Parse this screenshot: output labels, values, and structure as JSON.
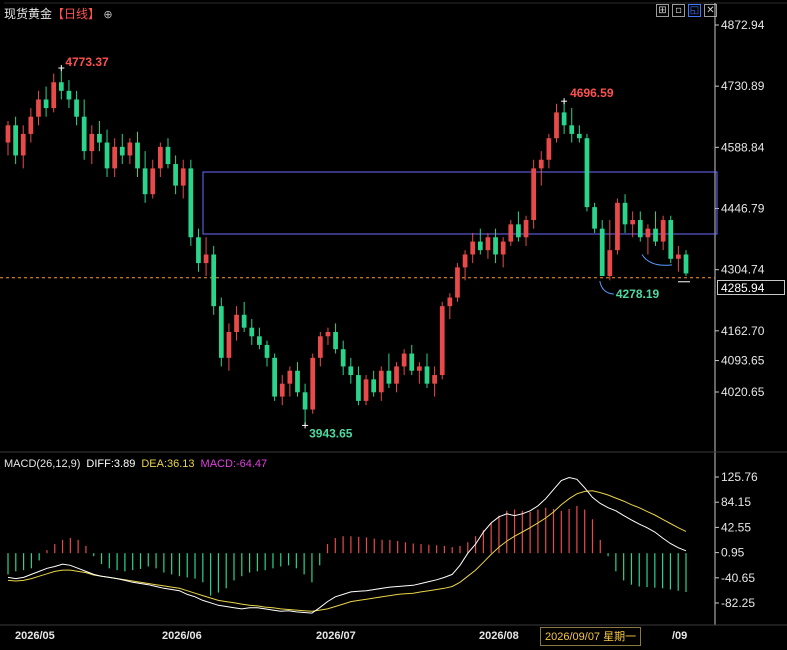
{
  "header": {
    "symbol": "现货黄金",
    "timeframe": "【日线】",
    "add_icon": "circle-plus-icon",
    "window_buttons": [
      {
        "name": "crosshair-icon",
        "glyph": "⊞"
      },
      {
        "name": "minimize-icon",
        "glyph": "▫"
      },
      {
        "name": "expand-icon",
        "glyph": "◱"
      },
      {
        "name": "close-icon",
        "glyph": "✕"
      }
    ]
  },
  "colors": {
    "up": "#e84a4a",
    "down": "#2ad48b",
    "diff_line": "#ffffff",
    "dea_line": "#e8d44a",
    "box": "#6b6bff",
    "dashed": "#ff9a2e",
    "axis": "#c8c8c8",
    "annot_high": "#ff5050",
    "annot_low": "#4dd9a0"
  },
  "price_panel": {
    "y_ticks": [
      "4872.94",
      "4730.89",
      "4588.84",
      "4446.79",
      "4304.74",
      "4162.70",
      "4093.65",
      "4020.65"
    ],
    "current_price": "4285.94",
    "annotations": {
      "high_label": "4773.37",
      "mid_high_label": "4696.59",
      "low_label": "3943.65",
      "recent_low_label": "4278.19"
    }
  },
  "macd_panel": {
    "title": "MACD(26,12,9)",
    "diff_text": "DIFF:3.89",
    "dea_text": "DEA:36.13",
    "macd_text": "MACD:-64.47",
    "y_ticks": [
      "125.76",
      "84.15",
      "42.55",
      "0.95",
      "-40.65",
      "-82.25"
    ]
  },
  "x_axis": {
    "labels": [
      "2026/05",
      "2026/06",
      "2026/07",
      "2026/08",
      "/09"
    ],
    "hover_label": "2026/09/07 星期一"
  },
  "chart_data": [
    {
      "type": "candlestick",
      "title": "现货黄金【日线】",
      "ylim": [
        3943.65,
        4872.94
      ],
      "y_ticks": [
        4872.94,
        4730.89,
        4588.84,
        4446.79,
        4304.74,
        4162.7,
        4093.65,
        4020.65
      ],
      "x_labels": [
        "2026/05",
        "2026/06",
        "2026/07",
        "2026/08",
        "/09"
      ],
      "current_price": 4285.94,
      "annotated_high": 4773.37,
      "annotated_high_2": 4696.59,
      "annotated_low": 3943.65,
      "annotated_recent_low": 4278.19,
      "candles": [
        [
          4600,
          4650,
          4570,
          4640
        ],
        [
          4640,
          4660,
          4550,
          4570
        ],
        [
          4570,
          4640,
          4540,
          4620
        ],
        [
          4620,
          4680,
          4600,
          4660
        ],
        [
          4660,
          4720,
          4640,
          4700
        ],
        [
          4700,
          4730,
          4660,
          4680
        ],
        [
          4680,
          4760,
          4670,
          4740
        ],
        [
          4740,
          4773,
          4700,
          4720
        ],
        [
          4720,
          4745,
          4680,
          4700
        ],
        [
          4700,
          4720,
          4640,
          4660
        ],
        [
          4660,
          4700,
          4560,
          4580
        ],
        [
          4580,
          4640,
          4550,
          4620
        ],
        [
          4620,
          4650,
          4580,
          4600
        ],
        [
          4600,
          4630,
          4520,
          4540
        ],
        [
          4540,
          4610,
          4520,
          4590
        ],
        [
          4590,
          4620,
          4550,
          4570
        ],
        [
          4570,
          4610,
          4550,
          4600
        ],
        [
          4600,
          4625,
          4520,
          4540
        ],
        [
          4540,
          4580,
          4460,
          4480
        ],
        [
          4480,
          4560,
          4470,
          4540
        ],
        [
          4540,
          4600,
          4520,
          4590
        ],
        [
          4590,
          4610,
          4540,
          4550
        ],
        [
          4550,
          4570,
          4480,
          4500
        ],
        [
          4500,
          4560,
          4470,
          4540
        ],
        [
          4540,
          4560,
          4360,
          4380
        ],
        [
          4380,
          4400,
          4300,
          4320
        ],
        [
          4320,
          4380,
          4290,
          4340
        ],
        [
          4340,
          4360,
          4200,
          4220
        ],
        [
          4220,
          4240,
          4080,
          4100
        ],
        [
          4100,
          4180,
          4070,
          4160
        ],
        [
          4160,
          4220,
          4140,
          4200
        ],
        [
          4200,
          4230,
          4160,
          4170
        ],
        [
          4170,
          4190,
          4130,
          4150
        ],
        [
          4150,
          4170,
          4120,
          4130
        ],
        [
          4130,
          4140,
          4080,
          4100
        ],
        [
          4100,
          4110,
          4000,
          4010
        ],
        [
          4010,
          4060,
          3990,
          4040
        ],
        [
          4040,
          4080,
          4010,
          4070
        ],
        [
          4070,
          4090,
          4010,
          4020
        ],
        [
          4020,
          4040,
          3943,
          3980
        ],
        [
          3980,
          4110,
          3970,
          4100
        ],
        [
          4100,
          4160,
          4080,
          4150
        ],
        [
          4150,
          4170,
          4130,
          4160
        ],
        [
          4160,
          4180,
          4110,
          4120
        ],
        [
          4120,
          4140,
          4060,
          4080
        ],
        [
          4080,
          4100,
          4040,
          4060
        ],
        [
          4060,
          4080,
          3990,
          4000
        ],
        [
          4000,
          4060,
          3990,
          4050
        ],
        [
          4050,
          4070,
          4010,
          4020
        ],
        [
          4020,
          4080,
          4000,
          4070
        ],
        [
          4070,
          4110,
          4030,
          4040
        ],
        [
          4040,
          4090,
          4020,
          4080
        ],
        [
          4080,
          4120,
          4060,
          4110
        ],
        [
          4110,
          4130,
          4060,
          4070
        ],
        [
          4070,
          4090,
          4040,
          4080
        ],
        [
          4080,
          4110,
          4030,
          4040
        ],
        [
          4040,
          4080,
          4010,
          4060
        ],
        [
          4060,
          4230,
          4050,
          4220
        ],
        [
          4220,
          4250,
          4190,
          4240
        ],
        [
          4240,
          4320,
          4230,
          4310
        ],
        [
          4310,
          4350,
          4280,
          4340
        ],
        [
          4340,
          4390,
          4320,
          4370
        ],
        [
          4370,
          4400,
          4340,
          4350
        ],
        [
          4350,
          4390,
          4330,
          4380
        ],
        [
          4380,
          4400,
          4320,
          4340
        ],
        [
          4340,
          4380,
          4310,
          4370
        ],
        [
          4370,
          4420,
          4360,
          4410
        ],
        [
          4410,
          4440,
          4370,
          4380
        ],
        [
          4380,
          4430,
          4360,
          4420
        ],
        [
          4420,
          4560,
          4400,
          4540
        ],
        [
          4540,
          4580,
          4500,
          4560
        ],
        [
          4560,
          4620,
          4540,
          4610
        ],
        [
          4610,
          4690,
          4600,
          4670
        ],
        [
          4670,
          4696,
          4620,
          4640
        ],
        [
          4640,
          4680,
          4600,
          4620
        ],
        [
          4620,
          4640,
          4600,
          4610
        ],
        [
          4610,
          4620,
          4440,
          4450
        ],
        [
          4450,
          4460,
          4390,
          4400
        ],
        [
          4400,
          4420,
          4300,
          4290
        ],
        [
          4290,
          4420,
          4280,
          4350
        ],
        [
          4350,
          4470,
          4340,
          4460
        ],
        [
          4460,
          4480,
          4390,
          4410
        ],
        [
          4410,
          4440,
          4380,
          4420
        ],
        [
          4420,
          4440,
          4370,
          4380
        ],
        [
          4380,
          4410,
          4340,
          4400
        ],
        [
          4400,
          4440,
          4360,
          4370
        ],
        [
          4370,
          4430,
          4350,
          4420
        ],
        [
          4420,
          4430,
          4320,
          4330
        ],
        [
          4330,
          4360,
          4300,
          4340
        ],
        [
          4340,
          4350,
          4290,
          4296
        ]
      ]
    },
    {
      "type": "bar",
      "title": "MACD(26,12,9)",
      "ylim": [
        -100,
        140
      ],
      "y_ticks": [
        125.76,
        84.15,
        42.55,
        0.95,
        -40.65,
        -82.25
      ],
      "last_diff": 3.89,
      "last_dea": 36.13,
      "last_macd": -64.47,
      "series": [
        {
          "name": "MACD",
          "values": [
            -35,
            -30,
            -28,
            -25,
            -12,
            5,
            15,
            22,
            25,
            22,
            12,
            -5,
            -18,
            -25,
            -28,
            -30,
            -28,
            -26,
            -22,
            -25,
            -32,
            -35,
            -38,
            -40,
            -42,
            -48,
            -70,
            -65,
            -58,
            -45,
            -38,
            -32,
            -30,
            -28,
            -25,
            -22,
            -20,
            -25,
            -35,
            -48,
            -20,
            15,
            25,
            28,
            28,
            27,
            26,
            24,
            22,
            22,
            20,
            18,
            16,
            15,
            14,
            13,
            12,
            10,
            12,
            18,
            28,
            38,
            50,
            62,
            70,
            72,
            70,
            68,
            72,
            75,
            73,
            70,
            73,
            78,
            72,
            56,
            22,
            -5,
            -30,
            -45,
            -52,
            -55,
            -56,
            -57,
            -58,
            -60,
            -62,
            -64
          ]
        },
        {
          "name": "DIFF",
          "values": [
            -40,
            -42,
            -40,
            -35,
            -30,
            -25,
            -22,
            -18,
            -20,
            -25,
            -30,
            -35,
            -38,
            -40,
            -42,
            -45,
            -48,
            -50,
            -52,
            -55,
            -58,
            -60,
            -62,
            -68,
            -72,
            -78,
            -82,
            -86,
            -88,
            -90,
            -92,
            -90,
            -90,
            -92,
            -94,
            -96,
            -95,
            -97,
            -98,
            -99,
            -90,
            -80,
            -72,
            -68,
            -64,
            -63,
            -62,
            -60,
            -58,
            -56,
            -55,
            -54,
            -53,
            -50,
            -47,
            -44,
            -40,
            -35,
            -20,
            0,
            15,
            35,
            50,
            60,
            65,
            62,
            65,
            70,
            78,
            90,
            105,
            120,
            125,
            122,
            108,
            92,
            82,
            75,
            70,
            62,
            55,
            48,
            42,
            35,
            25,
            16,
            9,
            4
          ]
        },
        {
          "name": "DEA",
          "values": [
            -45,
            -46,
            -45,
            -42,
            -38,
            -34,
            -30,
            -28,
            -28,
            -30,
            -32,
            -36,
            -38,
            -40,
            -42,
            -44,
            -46,
            -48,
            -50,
            -52,
            -54,
            -56,
            -58,
            -62,
            -66,
            -70,
            -74,
            -78,
            -80,
            -82,
            -84,
            -86,
            -87,
            -89,
            -90,
            -92,
            -93,
            -94,
            -95,
            -96,
            -94,
            -92,
            -88,
            -84,
            -80,
            -78,
            -76,
            -74,
            -72,
            -70,
            -68,
            -67,
            -66,
            -64,
            -62,
            -60,
            -58,
            -55,
            -48,
            -38,
            -28,
            -15,
            -2,
            10,
            20,
            28,
            35,
            42,
            50,
            58,
            68,
            80,
            90,
            98,
            102,
            103,
            100,
            96,
            91,
            86,
            80,
            75,
            69,
            63,
            56,
            49,
            42,
            36
          ]
        }
      ]
    }
  ]
}
